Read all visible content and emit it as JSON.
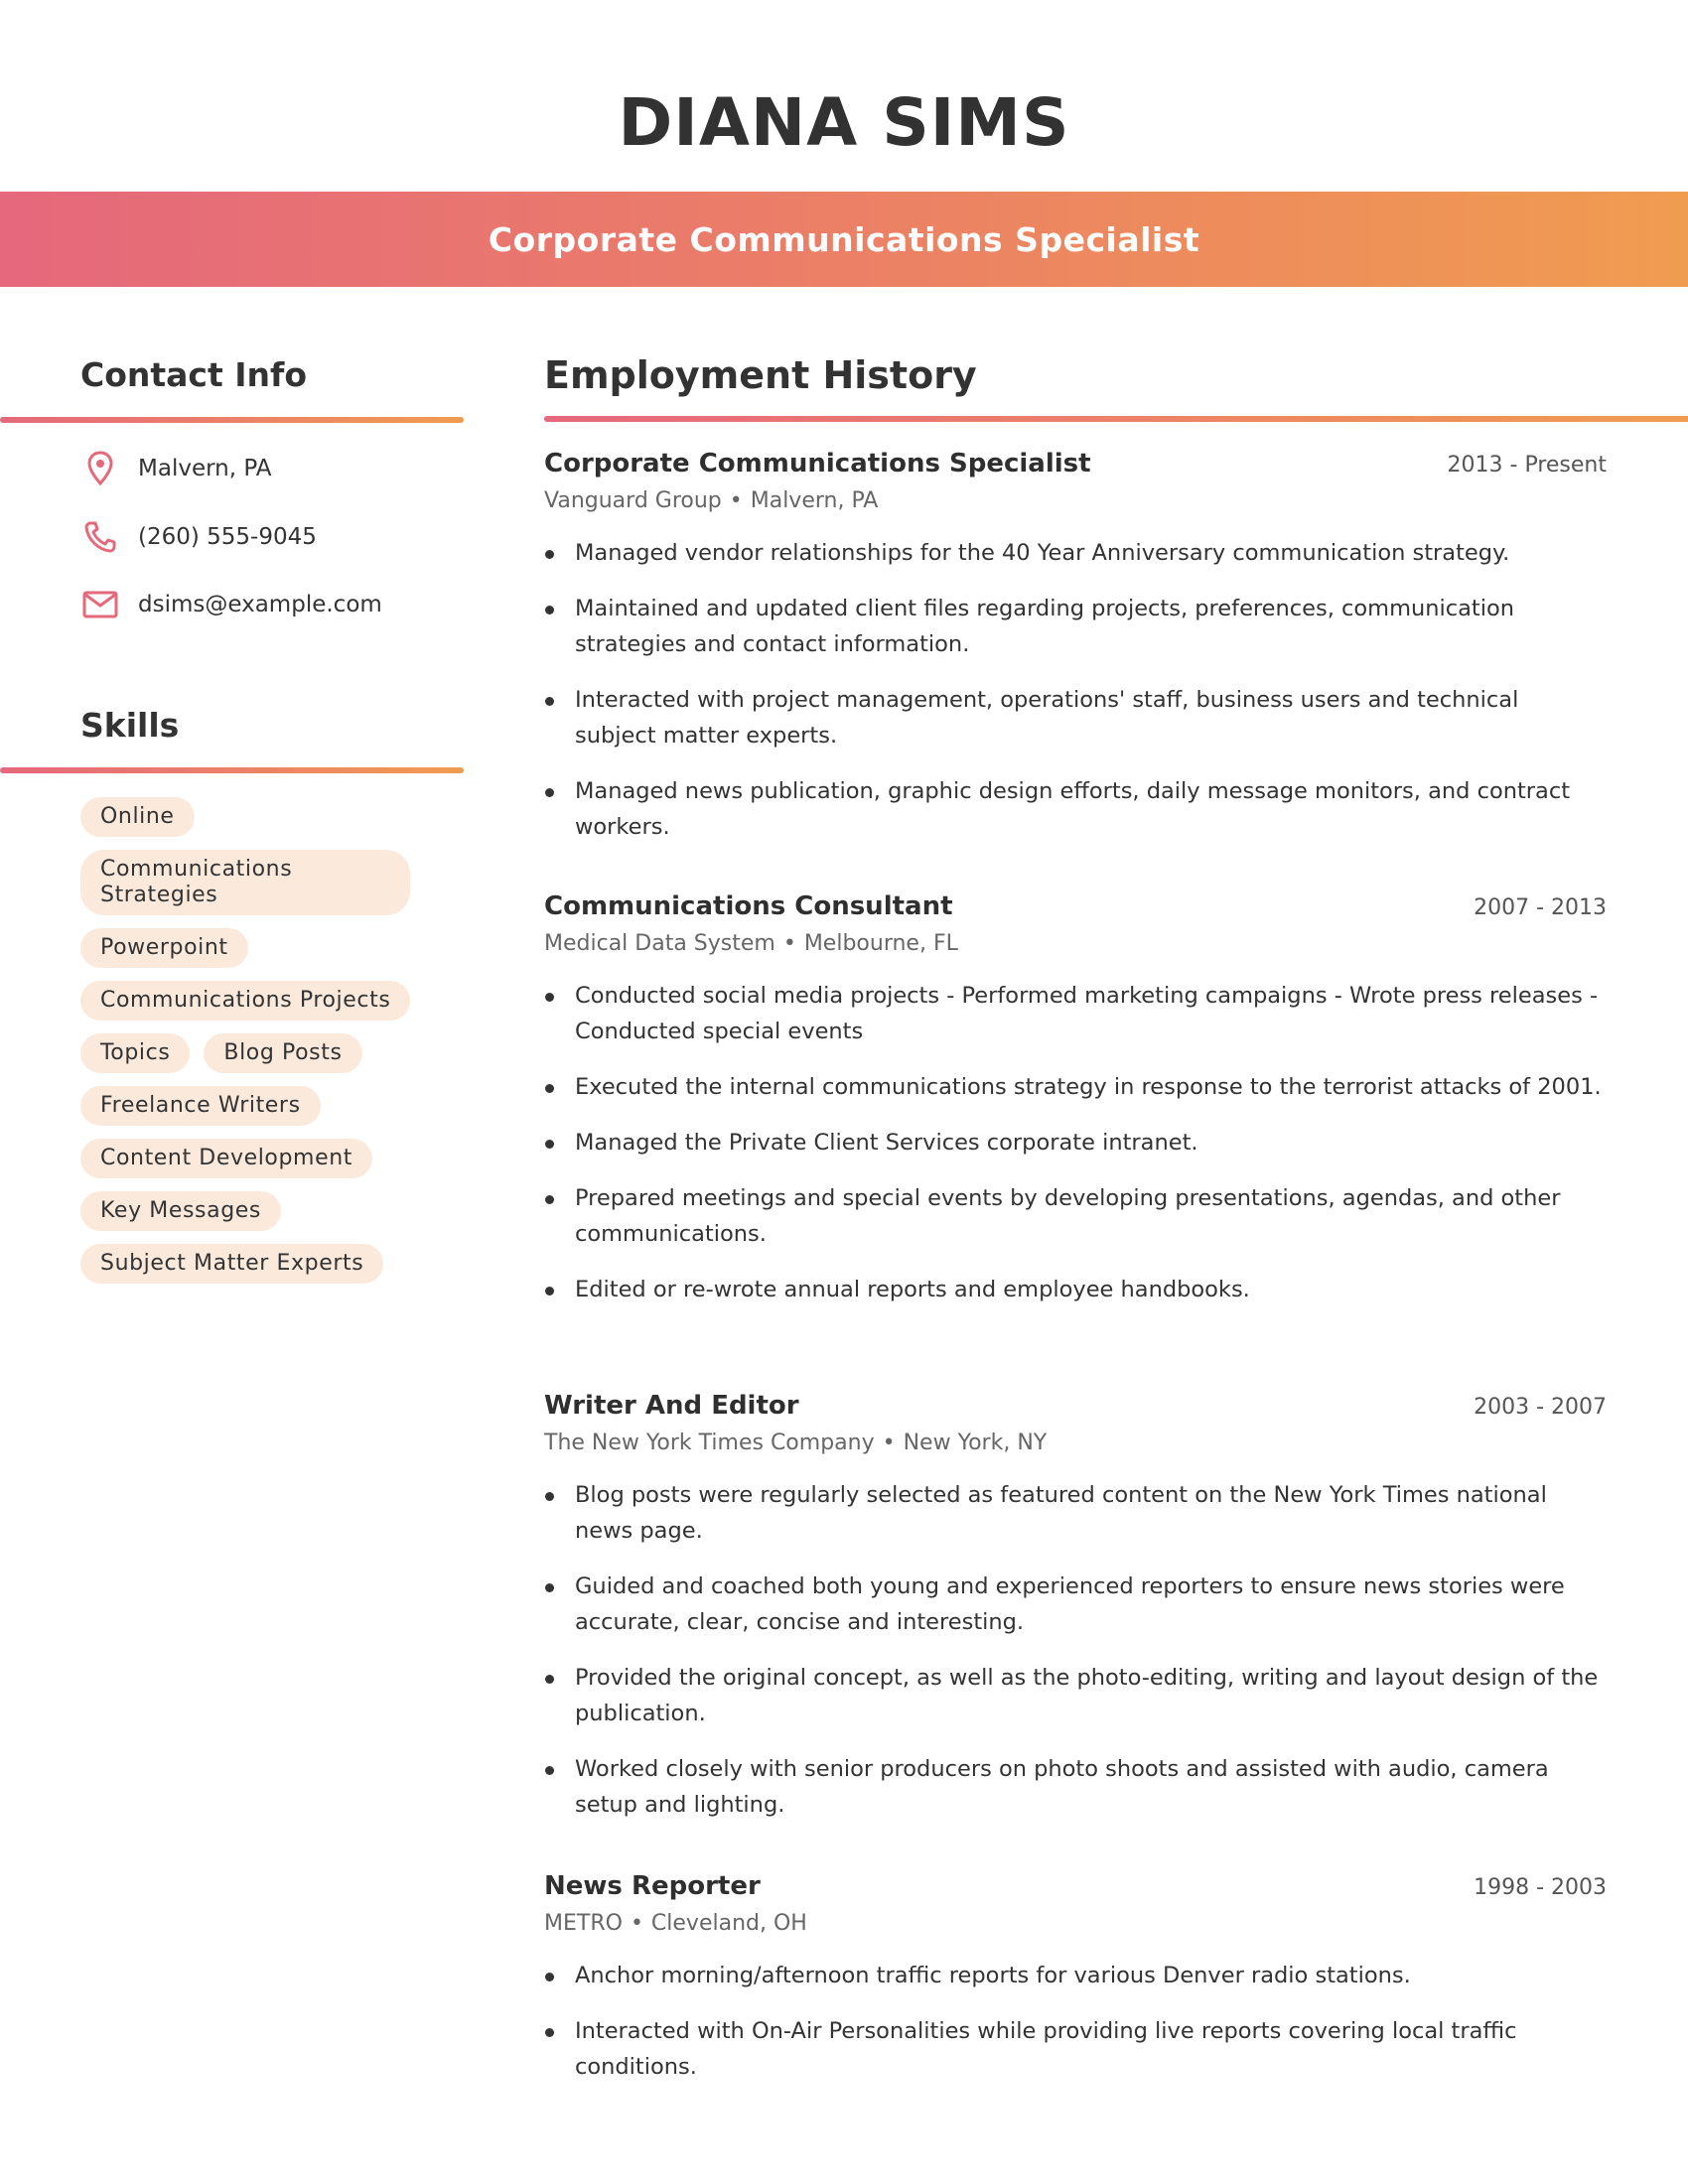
{
  "header": {
    "name": "DIANA SIMS",
    "title": "Corporate Communications Specialist"
  },
  "colors": {
    "gradient_start": "#e5687c",
    "gradient_end": "#f09c50",
    "icon": "#e4697a",
    "chip_bg": "#fbeadc",
    "text": "#333333"
  },
  "contact": {
    "heading": "Contact Info",
    "items": [
      {
        "icon": "map-pin-icon",
        "text": "Malvern, PA"
      },
      {
        "icon": "phone-icon",
        "text": "(260) 555-9045"
      },
      {
        "icon": "mail-icon",
        "text": "dsims@example.com"
      }
    ]
  },
  "skills": {
    "heading": "Skills",
    "items": [
      "Online",
      "Communications Strategies",
      "Powerpoint",
      "Communications Projects",
      "Topics",
      "Blog Posts",
      "Freelance Writers",
      "Content Development",
      "Key Messages",
      "Subject Matter Experts"
    ]
  },
  "employment": {
    "heading": "Employment History",
    "separator": "•",
    "jobs": [
      {
        "title": "Corporate Communications Specialist",
        "dates": "2013 - Present",
        "company": "Vanguard Group",
        "location": "Malvern, PA",
        "bullets": [
          "Managed vendor relationships for the 40 Year Anniversary communication strategy.",
          "Maintained and updated client files regarding projects, preferences, communication strategies and contact information.",
          "Interacted with project management, operations' staff, business users and technical subject matter experts.",
          "Managed news publication, graphic design efforts, daily message monitors, and contract workers."
        ]
      },
      {
        "title": "Communications Consultant",
        "dates": "2007 - 2013",
        "company": "Medical Data System",
        "location": "Melbourne, FL",
        "bullets": [
          "Conducted social media projects - Performed marketing campaigns - Wrote press releases - Conducted special events",
          "Executed the internal communications strategy in response to the terrorist attacks of 2001.",
          "Managed the Private Client Services corporate intranet.",
          "Prepared meetings and special events by developing presentations, agendas, and other communications.",
          "Edited or re-wrote annual reports and employee handbooks."
        ]
      },
      {
        "title": "Writer And Editor",
        "dates": "2003 - 2007",
        "company": "The New York Times Company",
        "location": "New York, NY",
        "bullets": [
          "Blog posts were regularly selected as featured content on the New York Times national news page.",
          "Guided and coached both young and experienced reporters to ensure news stories were accurate, clear, concise and interesting.",
          "Provided the original concept, as well as the photo-editing, writing and layout design of the publication.",
          "Worked closely with senior producers on photo shoots and assisted with audio, camera setup and lighting."
        ]
      },
      {
        "title": "News Reporter",
        "dates": "1998 - 2003",
        "company": "METRO",
        "location": "Cleveland, OH",
        "bullets": [
          "Anchor morning/afternoon traffic reports for various Denver radio stations.",
          "Interacted with On-Air Personalities while providing live reports covering local traffic conditions."
        ]
      }
    ]
  }
}
